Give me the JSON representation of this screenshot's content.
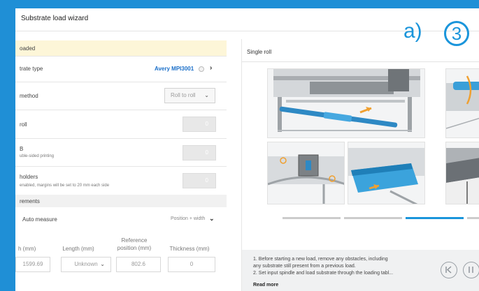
{
  "window": {
    "title": "Substrate load wizard",
    "step_letter": "a)",
    "step_number": "3"
  },
  "left": {
    "banner": "oaded",
    "substrate_type": {
      "label": "trate type",
      "value": "Avery MPI3001"
    },
    "method": {
      "label": "method",
      "value": "Roll to roll"
    },
    "roll": {
      "label": "roll",
      "value": "0"
    },
    "double_sided": {
      "label": "B",
      "sub": "uble-sided printing",
      "value": "0"
    },
    "holders": {
      "label": "holders",
      "sub": "enabled, margins will be set to 20 mm each side",
      "value": "0"
    },
    "measurements": {
      "section_label": "rements",
      "auto_measure": "Auto measure",
      "position_width": "Position + width",
      "columns": {
        "width": "h (mm)",
        "length": "Length (mm)",
        "reference": "Reference position (mm)",
        "thickness": "Thickness (mm)"
      },
      "values": {
        "width": "1599.69",
        "length": "Unknown",
        "reference": "802.6",
        "thickness": "0"
      }
    }
  },
  "right": {
    "header": "Single roll",
    "instructions": [
      "1. Before starting a new load, remove any obstacles, including",
      "any substrate still present from a previous load.",
      "2. Set input spindle and load substrate through the loading tabl..."
    ],
    "read_more": "Read more",
    "colors": {
      "accent": "#1a95db",
      "banner": "#fdf6d8"
    }
  }
}
